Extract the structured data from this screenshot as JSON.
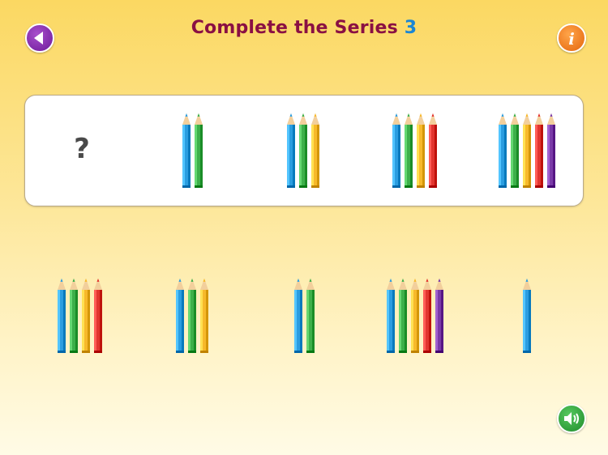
{
  "header": {
    "title": "Complete the Series",
    "level": "3"
  },
  "buttons": {
    "back": "back-arrow-icon",
    "info": "info-icon",
    "sound": "speaker-icon"
  },
  "series": {
    "missing_symbol": "?",
    "items": [
      {
        "count": "?",
        "pencils": []
      },
      {
        "count": 2,
        "pencils": [
          "blue",
          "green"
        ]
      },
      {
        "count": 3,
        "pencils": [
          "blue",
          "green",
          "yellow"
        ]
      },
      {
        "count": 4,
        "pencils": [
          "blue",
          "green",
          "yellow",
          "red"
        ]
      },
      {
        "count": 5,
        "pencils": [
          "blue",
          "green",
          "yellow",
          "red",
          "purple"
        ]
      }
    ]
  },
  "options": [
    {
      "count": 4,
      "pencils": [
        "blue",
        "green",
        "yellow",
        "red"
      ]
    },
    {
      "count": 3,
      "pencils": [
        "blue",
        "green",
        "yellow"
      ]
    },
    {
      "count": 2,
      "pencils": [
        "blue",
        "green"
      ]
    },
    {
      "count": 5,
      "pencils": [
        "blue",
        "green",
        "yellow",
        "red",
        "purple"
      ]
    },
    {
      "count": 1,
      "pencils": [
        "blue"
      ]
    }
  ],
  "colors": {
    "blue": "#2b9de0",
    "green": "#3db04a",
    "yellow": "#f7b92b",
    "red": "#e2352f",
    "purple": "#7a3aa8",
    "title": "#8a1043",
    "level": "#1a86d4"
  }
}
